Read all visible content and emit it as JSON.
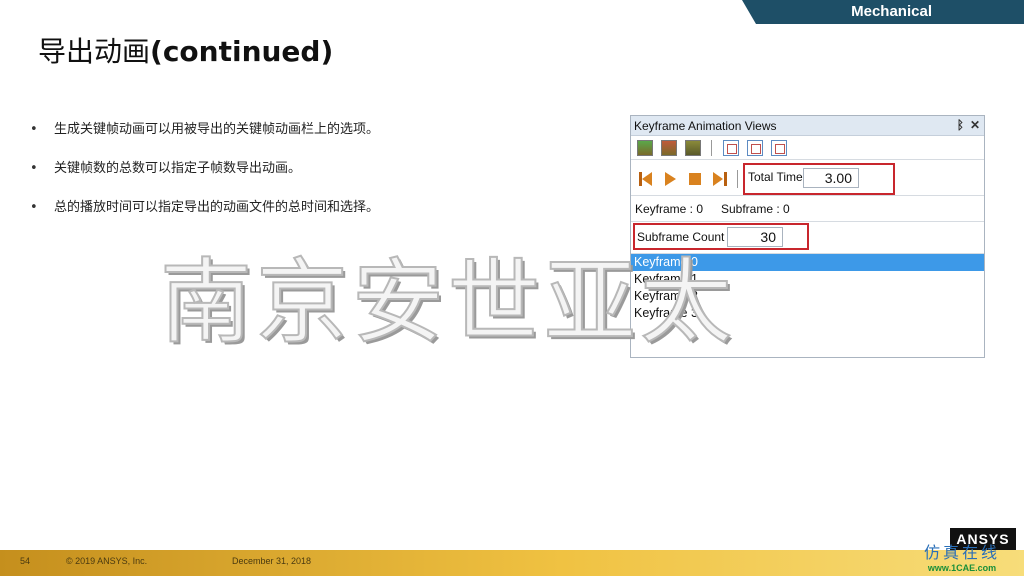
{
  "header": {
    "tag": "Mechanical",
    "title_cn": "导出动画",
    "title_en": "(continued)"
  },
  "bullets": [
    "生成关键帧动画可以用被导出的关键帧动画栏上的选项。",
    "关键帧数的总数可以指定子帧数导出动画。",
    "总的播放时间可以指定导出的动画文件的总时间和选择。"
  ],
  "watermark": "南京安世亚太",
  "panel": {
    "title": "Keyframe Animation Views",
    "pin_icon": "📌",
    "close_icon": "✕",
    "total_time_label": "Total Time",
    "total_time_value": "3.00",
    "keyframe_info": "Keyframe : 0",
    "subframe_info": "Subframe : 0",
    "subframe_count_label": "Subframe Count",
    "subframe_count_value": "30",
    "keyframes": [
      "Keyframe 0",
      "Keyframe 1",
      "Keyframe 2",
      "Keyframe 3"
    ]
  },
  "footer": {
    "page": "54",
    "copyright": "© 2019 ANSYS, Inc.",
    "date": "December 31, 2018",
    "logo": "ANSYS",
    "site_cn": "仿真在线",
    "site_en": "www.1CAE.com"
  },
  "colors": {
    "accent": "#1e4f67",
    "highlight_box": "#c8262d",
    "selection": "#3d99e8"
  }
}
